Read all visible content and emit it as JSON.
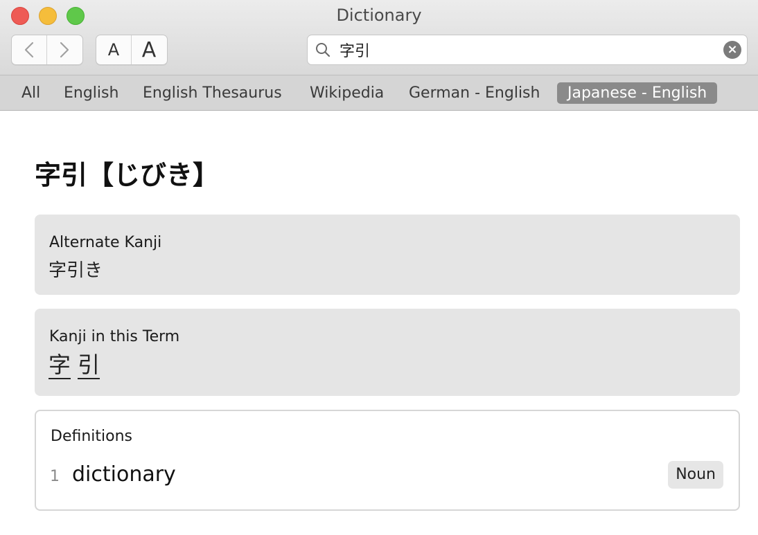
{
  "window": {
    "title": "Dictionary"
  },
  "toolbar": {
    "back_icon": "chevron-left-icon",
    "forward_icon": "chevron-right-icon",
    "font_smaller_label": "A",
    "font_larger_label": "A",
    "search_value": "字引",
    "search_placeholder": "Search",
    "search_icon": "magnifier-icon",
    "clear_icon": "clear-circle-icon"
  },
  "scope_tabs": [
    {
      "label": "All",
      "active": false
    },
    {
      "label": "English",
      "active": false
    },
    {
      "label": "English Thesaurus",
      "active": false
    },
    {
      "label": "Wikipedia",
      "active": false
    },
    {
      "label": "German - English",
      "active": false
    },
    {
      "label": "Japanese - English",
      "active": true
    }
  ],
  "entry": {
    "headword": "字引【じびき】",
    "alternate": {
      "label": "Alternate Kanji",
      "value": "字引き"
    },
    "kanji_in_term": {
      "label": "Kanji in this Term",
      "items": [
        "字",
        "引"
      ]
    },
    "definitions": {
      "label": "Definitions",
      "items": [
        {
          "number": "1",
          "text": "dictionary",
          "pos": "Noun"
        }
      ]
    }
  },
  "colors": {
    "close": "#ee5b55",
    "minimize": "#f5bd3b",
    "maximize": "#5fc84a",
    "active_tab": "#8a8a8a",
    "card_background": "#e5e5e5"
  }
}
